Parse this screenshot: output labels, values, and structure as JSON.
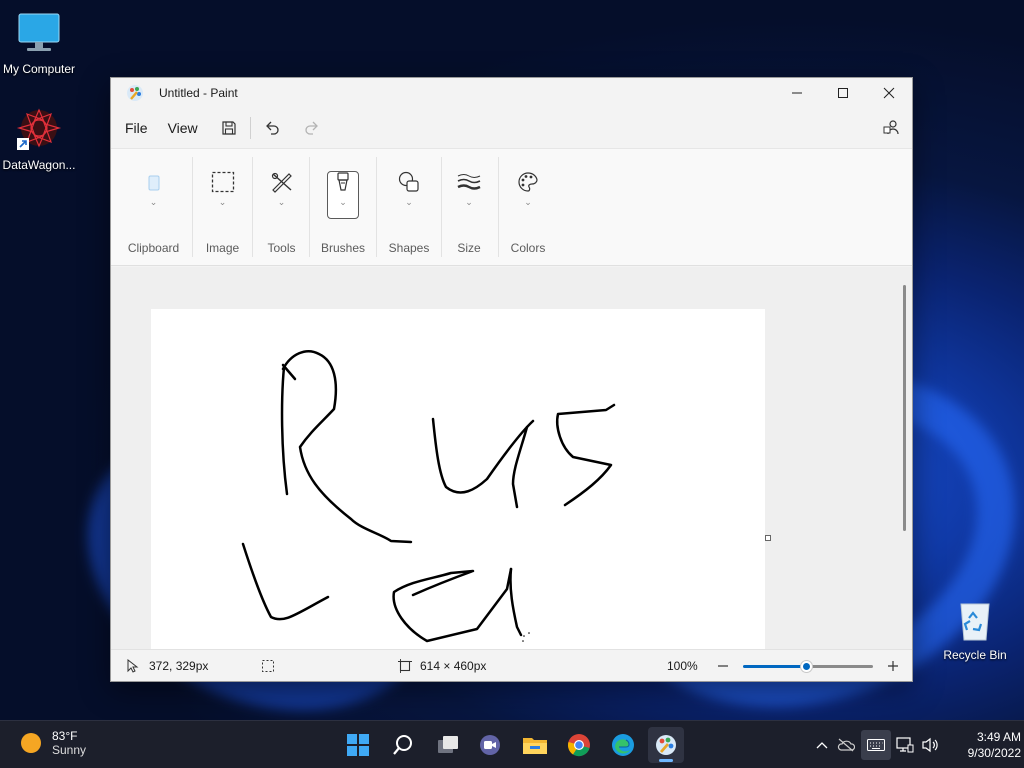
{
  "desktop": {
    "icons": [
      {
        "label": "My Computer"
      },
      {
        "label": "DataWagon..."
      },
      {
        "label": "Recycle Bin"
      }
    ]
  },
  "window": {
    "title": "Untitled - Paint",
    "menu": {
      "file": "File",
      "view": "View"
    },
    "ribbon": {
      "groups": [
        "Clipboard",
        "Image",
        "Tools",
        "Brushes",
        "Shapes",
        "Size",
        "Colors"
      ]
    },
    "status": {
      "cursor_pos": "372, 329px",
      "canvas_size": "614 × 460px",
      "zoom": "100%",
      "zoom_level": 0.5
    },
    "colors": {
      "accent": "#0067c0"
    }
  },
  "taskbar": {
    "weather": {
      "temp": "83°F",
      "condition": "Sunny"
    },
    "clock": {
      "time": "3:49 AM",
      "date": "9/30/2022"
    }
  }
}
